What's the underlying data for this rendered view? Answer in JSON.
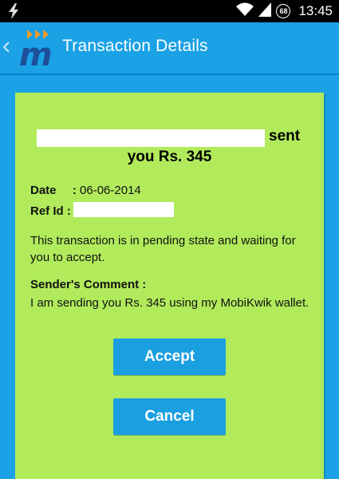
{
  "status_bar": {
    "time": "13:45",
    "battery_badge": "68"
  },
  "header": {
    "title": "Transaction Details"
  },
  "transaction": {
    "sent_text": "sent",
    "amount_text": "you Rs. 345",
    "date_label": "Date",
    "date_sep": ":",
    "date_value": "06-06-2014",
    "ref_label": "Ref Id :",
    "pending_message": "This transaction is in pending state and waiting for you to accept.",
    "comment_label": "Sender's Comment :",
    "comment_text": "I am sending you Rs. 345 using my MobiKwik wallet."
  },
  "actions": {
    "accept_label": "Accept",
    "cancel_label": "Cancel"
  },
  "colors": {
    "action_bar": "#1aa1e6",
    "card": "#b1eb5c",
    "button": "#1a9fe0"
  },
  "icons": [
    "lightning-icon",
    "wifi-icon",
    "signal-icon",
    "battery-badge-icon",
    "back-chevron-icon",
    "mobikwik-logo"
  ]
}
